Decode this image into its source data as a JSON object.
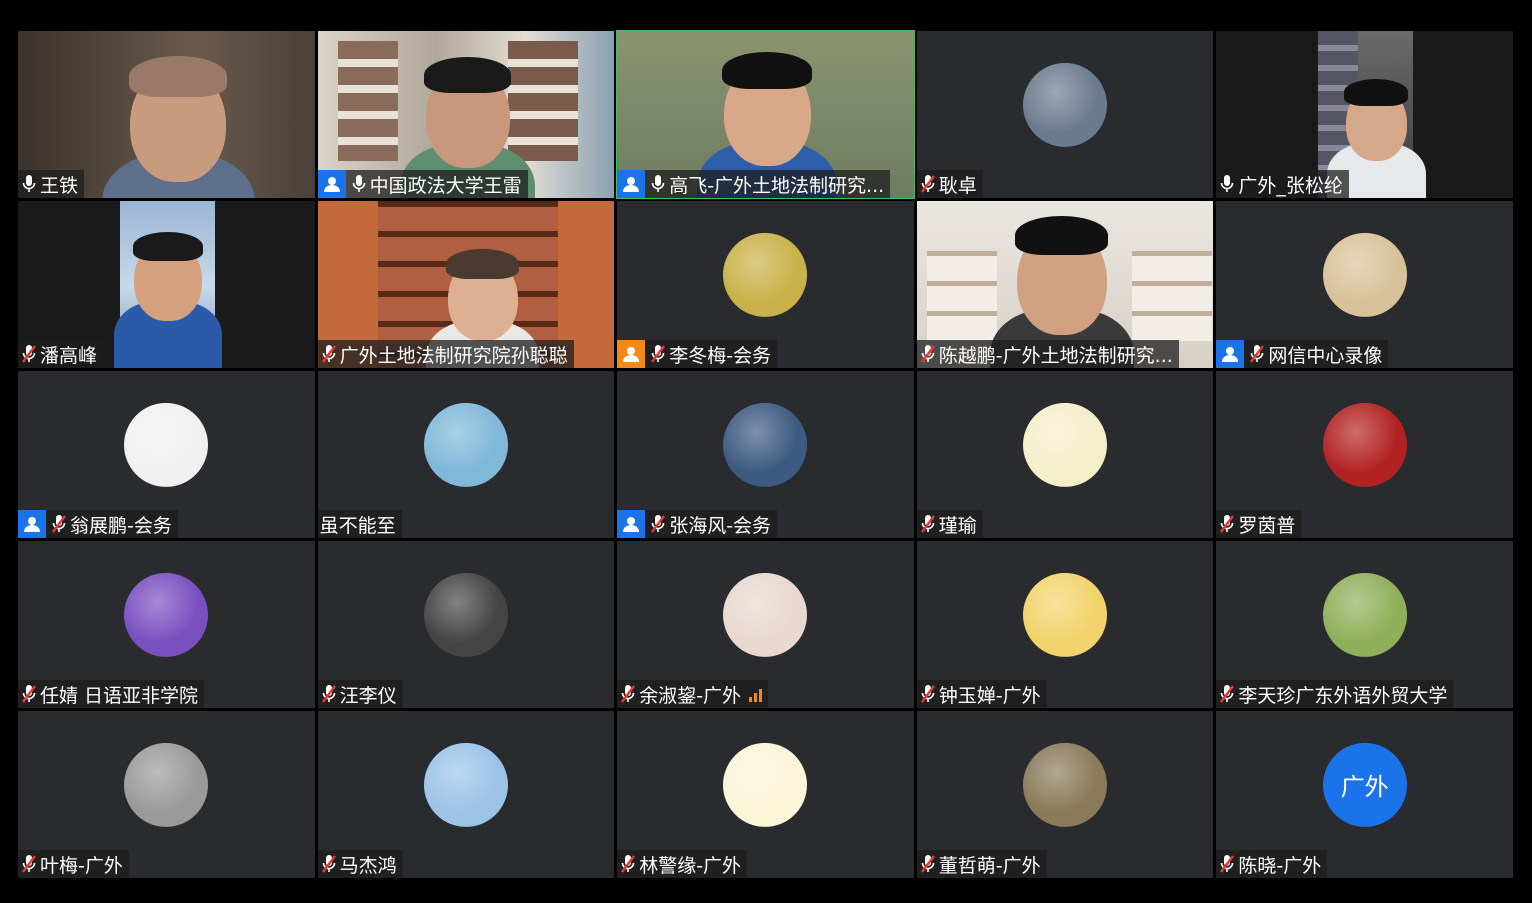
{
  "meeting": {
    "participants": [
      {
        "name": "王铁",
        "mic": "on",
        "host": "",
        "kind": "video",
        "v": "man-bald"
      },
      {
        "name": "中国政法大学王雷",
        "mic": "on",
        "host": "blue",
        "kind": "video",
        "v": "man-shelf"
      },
      {
        "name": "高飞-广外土地法制研究...",
        "mic": "on",
        "host": "blue",
        "kind": "video",
        "v": "man-blue",
        "speaking": true
      },
      {
        "name": "耿卓",
        "mic": "muted",
        "host": "",
        "kind": "avatar",
        "av": "photo-man",
        "avColor": "#6b7b8f"
      },
      {
        "name": "广外_张松纶",
        "mic": "on",
        "host": "",
        "kind": "video",
        "v": "man-narrow"
      },
      {
        "name": "潘高峰",
        "mic": "muted",
        "host": "",
        "kind": "video",
        "v": "man-narrow2"
      },
      {
        "name": "广外土地法制研究院孙聪聪",
        "mic": "muted",
        "host": "",
        "kind": "video",
        "v": "woman-books"
      },
      {
        "name": "李冬梅-会务",
        "mic": "muted",
        "host": "orange",
        "kind": "avatar",
        "av": "flowers",
        "avColor": "#c9b24a"
      },
      {
        "name": "陈越鹏-广外土地法制研究...",
        "mic": "muted",
        "host": "",
        "kind": "video",
        "v": "man-office"
      },
      {
        "name": "网信中心录像",
        "mic": "muted",
        "host": "blue",
        "kind": "avatar",
        "av": "pig",
        "avColor": "#d9c29a"
      },
      {
        "name": "翁展鹏-会务",
        "mic": "muted",
        "host": "blue",
        "kind": "avatar",
        "av": "anime-dark",
        "avColor": "#f0f0f0"
      },
      {
        "name": "虽不能至",
        "mic": "none",
        "host": "",
        "kind": "avatar",
        "av": "anime-girl",
        "avColor": "#7fb8d9"
      },
      {
        "name": "张海风-会务",
        "mic": "muted",
        "host": "blue",
        "kind": "avatar",
        "av": "stitch",
        "avColor": "#3d5a80"
      },
      {
        "name": "瑾瑜",
        "mic": "muted",
        "host": "",
        "kind": "avatar",
        "av": "whale",
        "avColor": "#f5eecb"
      },
      {
        "name": "罗茵普",
        "mic": "muted",
        "host": "",
        "kind": "avatar",
        "av": "poster",
        "avColor": "#b22222"
      },
      {
        "name": "任婧 日语亚非学院",
        "mic": "muted",
        "host": "",
        "kind": "avatar",
        "av": "purple",
        "avColor": "#7a4fc0"
      },
      {
        "name": "汪李仪",
        "mic": "muted",
        "host": "",
        "kind": "avatar",
        "av": "bw-photo",
        "avColor": "#444"
      },
      {
        "name": "余淑鋆-广外",
        "mic": "muted",
        "host": "",
        "kind": "avatar",
        "av": "woman-profile",
        "avColor": "#e8d8d0",
        "signal": true
      },
      {
        "name": "钟玉婵-广外",
        "mic": "muted",
        "host": "",
        "kind": "avatar",
        "av": "cat",
        "avColor": "#f2d36b"
      },
      {
        "name": "李天珍广东外语外贸大学",
        "mic": "muted",
        "host": "",
        "kind": "avatar",
        "av": "green",
        "avColor": "#8fb05a"
      },
      {
        "name": "叶梅-广外",
        "mic": "muted",
        "host": "",
        "kind": "avatar",
        "av": "flower-bw",
        "avColor": "#9a9a9a"
      },
      {
        "name": "马杰鸿",
        "mic": "muted",
        "host": "",
        "kind": "avatar",
        "av": "blue-girl",
        "avColor": "#9cc3e8"
      },
      {
        "name": "林警缘-广外",
        "mic": "muted",
        "host": "",
        "kind": "avatar",
        "av": "chick",
        "avColor": "#fbf5d8"
      },
      {
        "name": "董哲萌-广外",
        "mic": "muted",
        "host": "",
        "kind": "avatar",
        "av": "tom",
        "avColor": "#8a7a5a"
      },
      {
        "name": "陈晓-广外",
        "mic": "muted",
        "host": "",
        "kind": "avatar",
        "av": "text",
        "avText": "广外",
        "avColor": "#1a73e8"
      }
    ]
  },
  "colors": {
    "tile_bg": "#2a2b2e",
    "host_blue": "#1a73e8",
    "host_orange": "#f28a1a",
    "speaking_border": "#3fbf5f",
    "mute_red": "#e53935"
  }
}
